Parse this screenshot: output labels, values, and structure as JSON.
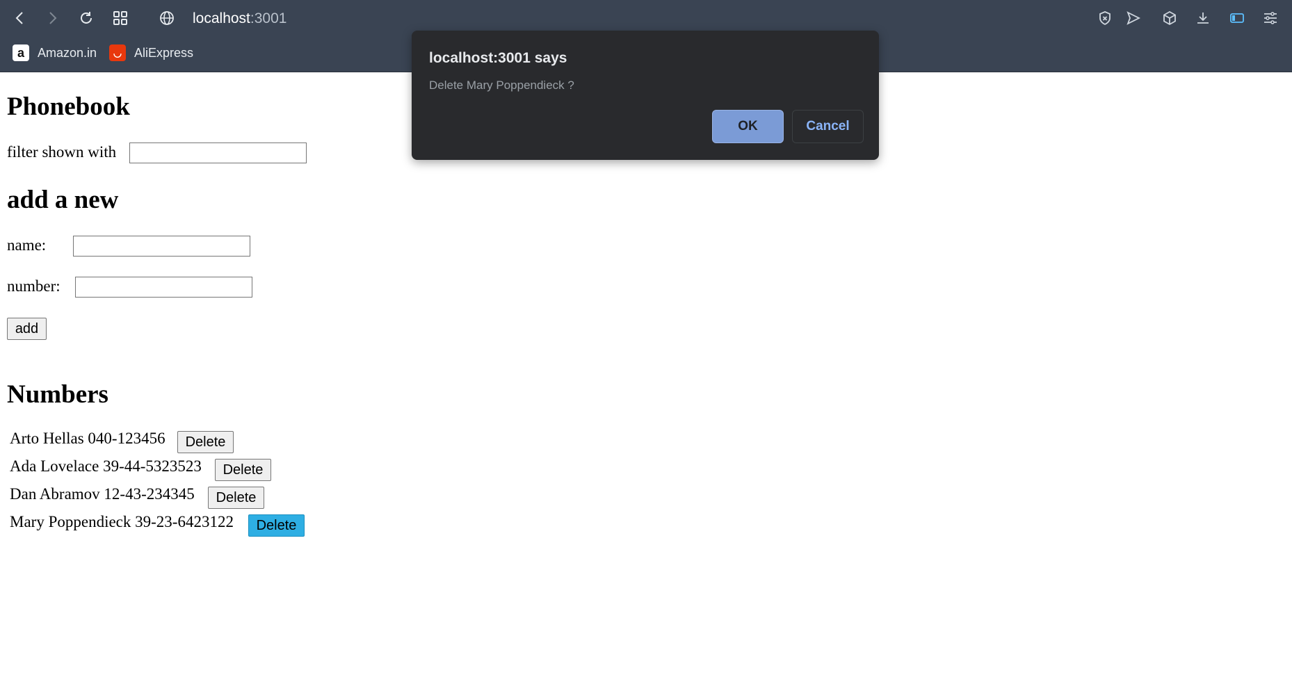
{
  "browser": {
    "url_host": "localhost",
    "url_port": ":3001",
    "bookmarks": [
      {
        "label": "Amazon.in",
        "icon": "amazon-icon"
      },
      {
        "label": "AliExpress",
        "icon": "aliexpress-icon"
      }
    ],
    "toolbar_icons": [
      "back-icon",
      "forward-icon",
      "reload-icon",
      "tabs-grid-icon",
      "globe-icon",
      "shield-icon",
      "send-icon",
      "cube-icon",
      "download-icon",
      "sidebar-icon",
      "menu-icon"
    ]
  },
  "page": {
    "title": "Phonebook",
    "filter_label": "filter shown with",
    "filter_value": "",
    "add_heading": "add a new",
    "name_label": "name:",
    "name_value": "",
    "number_label": "number:",
    "number_value": "",
    "add_button": "add",
    "numbers_heading": "Numbers",
    "delete_label": "Delete",
    "entries": [
      {
        "text": "Arto Hellas 040-123456"
      },
      {
        "text": "Ada Lovelace 39-44-5323523"
      },
      {
        "text": "Dan Abramov 12-43-234345"
      },
      {
        "text": "Mary Poppendieck 39-23-6423122"
      }
    ]
  },
  "dialog": {
    "title": "localhost:3001 says",
    "message": "Delete Mary Poppendieck ?",
    "ok_label": "OK",
    "cancel_label": "Cancel"
  },
  "colors": {
    "chrome_bg": "#3a4453",
    "dialog_bg": "#292a2d",
    "ok_bg": "#7b9bd6",
    "cancel_text": "#8ab4f8",
    "delete_hover_bg": "#2eaee3"
  }
}
